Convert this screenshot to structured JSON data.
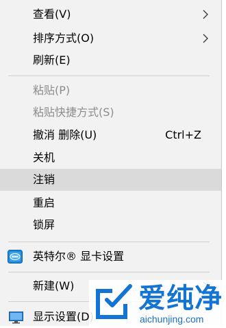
{
  "menu": {
    "items": [
      {
        "label": "查看(V)",
        "submenu": true
      },
      {
        "label": "排序方式(O)",
        "submenu": true
      },
      {
        "label": "刷新(E)"
      },
      {
        "label": "粘贴(P)",
        "disabled": true
      },
      {
        "label": "粘贴快捷方式(S)",
        "disabled": true
      },
      {
        "label": "撤消 删除(U)",
        "shortcut": "Ctrl+Z"
      },
      {
        "label": "关机"
      },
      {
        "label": "注销",
        "highlighted": true
      },
      {
        "label": "重启"
      },
      {
        "label": "锁屏"
      },
      {
        "label": "英特尔® 显卡设置",
        "icon": "intel-graphics-icon"
      },
      {
        "label": "新建(W)",
        "submenu": true
      },
      {
        "label": "显示设置(D)",
        "icon": "display-settings-icon"
      }
    ]
  },
  "watermark": {
    "text": "爱纯净",
    "url": "aichunjing.com",
    "icon": "aichunjing-logo-icon",
    "color": "#1474d3"
  },
  "colors": {
    "menu_background": "#f2f2f2",
    "highlight": "#dadada",
    "disabled_text": "#8c8c8c"
  }
}
